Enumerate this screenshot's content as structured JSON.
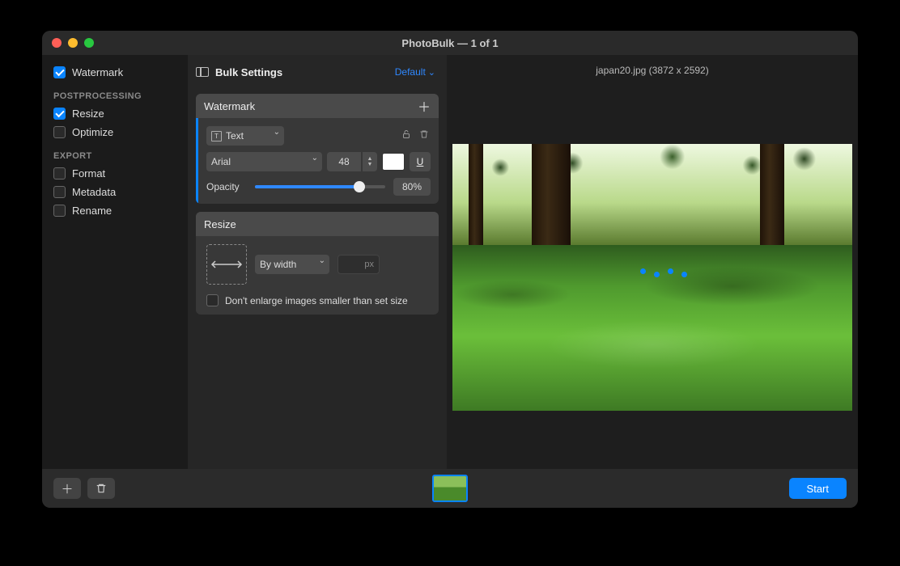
{
  "window": {
    "title": "PhotoBulk — 1 of 1"
  },
  "sidebar": {
    "items": [
      {
        "label": "Watermark",
        "checked": true
      }
    ],
    "groups": [
      {
        "title": "POSTPROCESSING",
        "items": [
          {
            "label": "Resize",
            "checked": true
          },
          {
            "label": "Optimize",
            "checked": false
          }
        ]
      },
      {
        "title": "EXPORT",
        "items": [
          {
            "label": "Format",
            "checked": false
          },
          {
            "label": "Metadata",
            "checked": false
          },
          {
            "label": "Rename",
            "checked": false
          }
        ]
      }
    ]
  },
  "settings": {
    "header": "Bulk Settings",
    "preset": "Default",
    "watermark": {
      "title": "Watermark",
      "type": "Text",
      "font": "Arial",
      "size": "48",
      "color": "#ffffff",
      "underline": "U",
      "opacity_label": "Opacity",
      "opacity_value": "80%",
      "opacity_pct": 80
    },
    "resize": {
      "title": "Resize",
      "mode": "By width",
      "unit": "px",
      "dont_enlarge_label": "Don't enlarge images smaller than set size",
      "dont_enlarge_checked": false
    }
  },
  "preview": {
    "info": "japan20.jpg (3872 x 2592)"
  },
  "footer": {
    "start": "Start"
  }
}
